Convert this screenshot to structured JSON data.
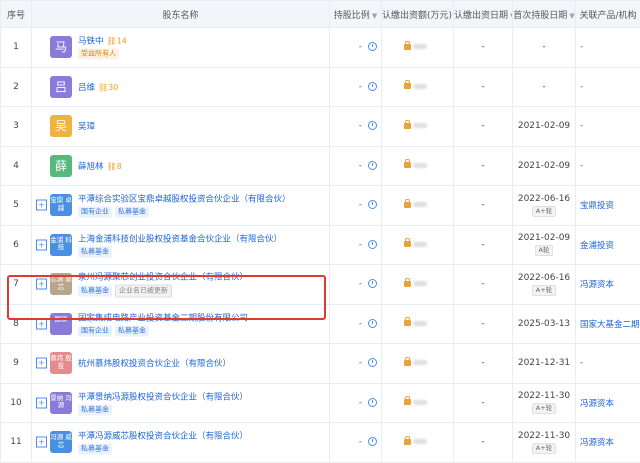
{
  "header": {
    "idx": "序号",
    "name": "股东名称",
    "ratio": "持股比例",
    "amount": "认缴出资额(万元)",
    "date_sub": "认缴出资日期",
    "date_hold": "首次持股日期",
    "product": "关联产品/机构"
  },
  "rows": [
    {
      "idx": "1",
      "logo": "马",
      "logo_color": "#8b7bd8",
      "name": "马铁中",
      "hcount": "14",
      "tags": [
        {
          "text": "受益所有人",
          "style": "orange"
        }
      ],
      "ratio": "-",
      "date_sub": "-",
      "date_hold": "-",
      "grade": "",
      "product": "-"
    },
    {
      "idx": "2",
      "logo": "吕",
      "logo_color": "#8b7bd8",
      "name": "吕维",
      "hcount": "30",
      "tags": [],
      "ratio": "-",
      "date_sub": "-",
      "date_hold": "-",
      "grade": "",
      "product": "-"
    },
    {
      "idx": "3",
      "logo": "吴",
      "logo_color": "#f0b342",
      "name": "吴璋",
      "hcount": "",
      "tags": [],
      "ratio": "-",
      "date_sub": "-",
      "date_hold": "2021-02-09",
      "grade": "",
      "product": "-"
    },
    {
      "idx": "4",
      "logo": "薛",
      "logo_color": "#56b87a",
      "name": "薛旭林",
      "hcount": "8",
      "tags": [],
      "ratio": "-",
      "date_sub": "-",
      "date_hold": "2021-02-09",
      "grade": "",
      "product": "-"
    },
    {
      "idx": "5",
      "logo": "宝鼎 卓越",
      "logo_color": "#4a90e2",
      "name": "平潭综合实验区宝鼎卓越股权投资合伙企业（有限合伙）",
      "hcount": "",
      "tags": [
        {
          "text": "国有企业",
          "style": "blue"
        },
        {
          "text": "私募基金",
          "style": "blue"
        }
      ],
      "ratio": "-",
      "date_sub": "-",
      "date_hold": "2022-06-16",
      "grade": "A+轮",
      "product": "宝鼎投资"
    },
    {
      "idx": "6",
      "logo": "金浦 科技",
      "logo_color": "#4a90e2",
      "name": "上海金浦科技创业股权投资基金合伙企业（有限合伙）",
      "hcount": "",
      "tags": [
        {
          "text": "私募基金",
          "style": "blue"
        }
      ],
      "ratio": "-",
      "date_sub": "-",
      "date_hold": "2021-02-09",
      "grade": "A轮",
      "product": "金浦投资"
    },
    {
      "idx": "7",
      "logo": "芯源 聚芯",
      "logo_color": "#b9a58a",
      "name": "泉州冯源聚芯创业投资合伙企业（有限合伙）",
      "hcount": "",
      "tags": [
        {
          "text": "私募基金",
          "style": "blue"
        },
        {
          "text": "企业名已被更新",
          "style": "grey"
        }
      ],
      "ratio": "-",
      "date_sub": "-",
      "date_hold": "2022-06-16",
      "grade": "A+轮",
      "product": "冯源资本"
    },
    {
      "idx": "8",
      "logo": "国家",
      "logo_color": "#8b7bd8",
      "name": "国家集成电路产业投资基金二期股份有限公司",
      "hcount": "",
      "tags": [
        {
          "text": "国有企业",
          "style": "blue"
        },
        {
          "text": "私募基金",
          "style": "blue"
        }
      ],
      "ratio": "-",
      "date_sub": "-",
      "date_hold": "2025-03-13",
      "grade": "",
      "product": "国家大基金二期"
    },
    {
      "idx": "9",
      "logo": "慕炜 股投",
      "logo_color": "#e58b8b",
      "name": "杭州慕炜股权投资合伙企业（有限合伙）",
      "hcount": "",
      "tags": [],
      "ratio": "-",
      "date_sub": "-",
      "date_hold": "2021-12-31",
      "grade": "",
      "product": "-"
    },
    {
      "idx": "10",
      "logo": "景纳 冯源",
      "logo_color": "#8b7bd8",
      "name": "平潭景纳冯源股权投资合伙企业（有限合伙）",
      "hcount": "",
      "tags": [
        {
          "text": "私募基金",
          "style": "blue"
        }
      ],
      "ratio": "-",
      "date_sub": "-",
      "date_hold": "2022-11-30",
      "grade": "A+轮",
      "product": "冯源资本"
    },
    {
      "idx": "11",
      "logo": "冯源 威芯",
      "logo_color": "#4a90e2",
      "name": "平潭冯源威芯股权投资合伙企业（有限合伙）",
      "hcount": "",
      "tags": [
        {
          "text": "私募基金",
          "style": "blue"
        }
      ],
      "ratio": "-",
      "date_sub": "-",
      "date_hold": "2022-11-30",
      "grade": "A+轮",
      "product": "冯源资本"
    }
  ]
}
